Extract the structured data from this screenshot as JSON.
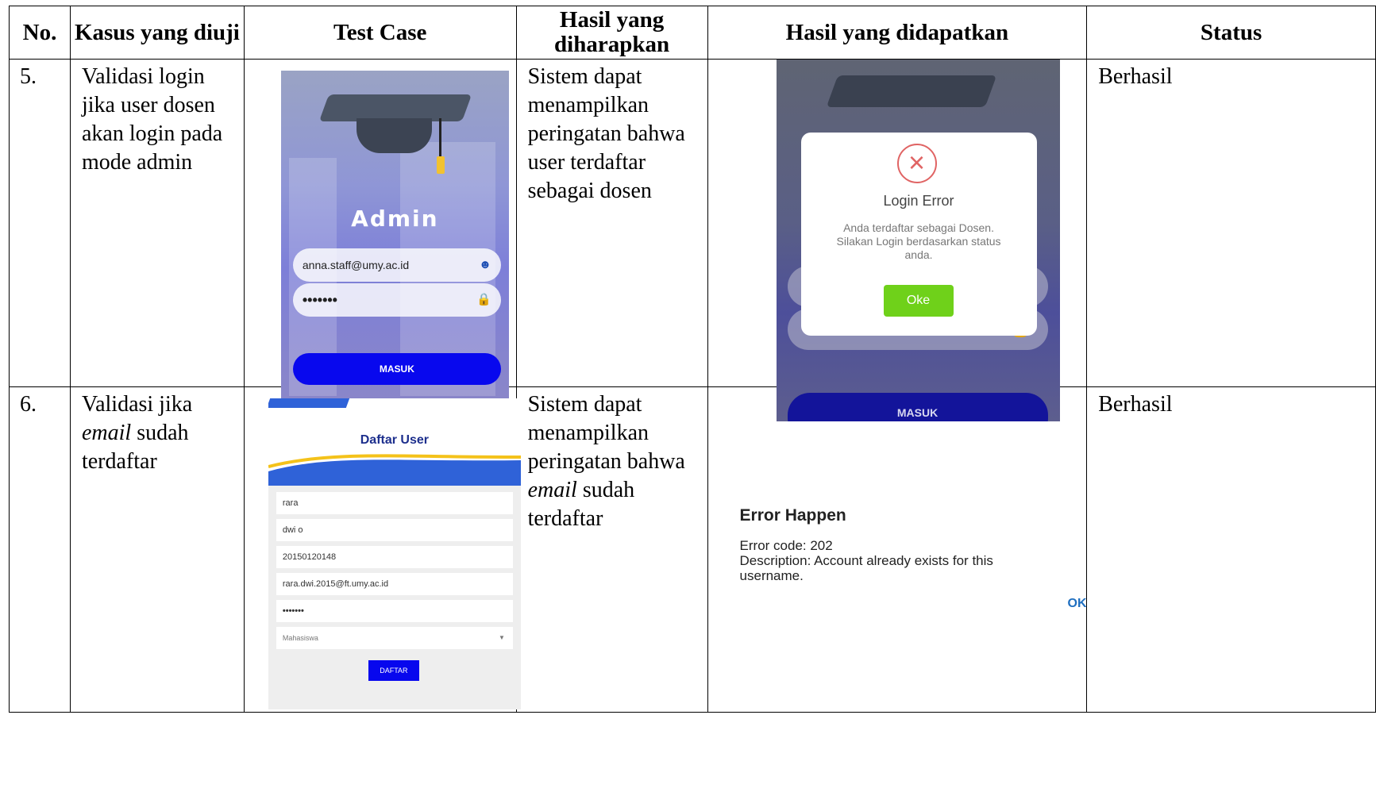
{
  "headers": {
    "no": "No.",
    "kasus": "Kasus yang diuji",
    "test_case": "Test Case",
    "harapan": "Hasil yang diharapkan",
    "didapatkan": "Hasil yang didapatkan",
    "status": "Status"
  },
  "rows": [
    {
      "no": "5.",
      "kasus": "Validasi login jika user dosen akan login pada mode admin",
      "harapan": "Sistem dapat menampilkan peringatan bahwa user terdaftar sebagai dosen",
      "status": "Berhasil",
      "test_case_screen": {
        "title": "Admin",
        "email": "anna.staff@umy.ac.id",
        "password": "•••••••",
        "button": "MASUK"
      },
      "result_screen": {
        "dialog_title": "Login Error",
        "dialog_message": "Anda terdaftar sebagai Dosen. Silakan Login berdasarkan status anda.",
        "dialog_button": "Oke",
        "password": "•••••••",
        "button": "MASUK"
      }
    },
    {
      "no": "6.",
      "kasus_part1": "Validasi jika",
      "kasus_em": "email",
      "kasus_part2": "sudah terdaftar",
      "harapan_part1": "Sistem dapat menampilkan peringatan bahwa",
      "harapan_em": "email",
      "harapan_part2": "sudah terdaftar",
      "status": "Berhasil",
      "test_case_screen": {
        "title": "Daftar User",
        "fields": [
          "rara",
          "dwi o",
          "20150120148",
          "rara.dwi.2015@ft.umy.ac.id",
          "•••••••"
        ],
        "select": "Mahasiswa",
        "button": "DAFTAR"
      },
      "result_screen": {
        "title": "Error Happen",
        "line1": "Error code: 202",
        "line2": "Description: Account already exists for this username.",
        "button": "OK"
      }
    }
  ]
}
